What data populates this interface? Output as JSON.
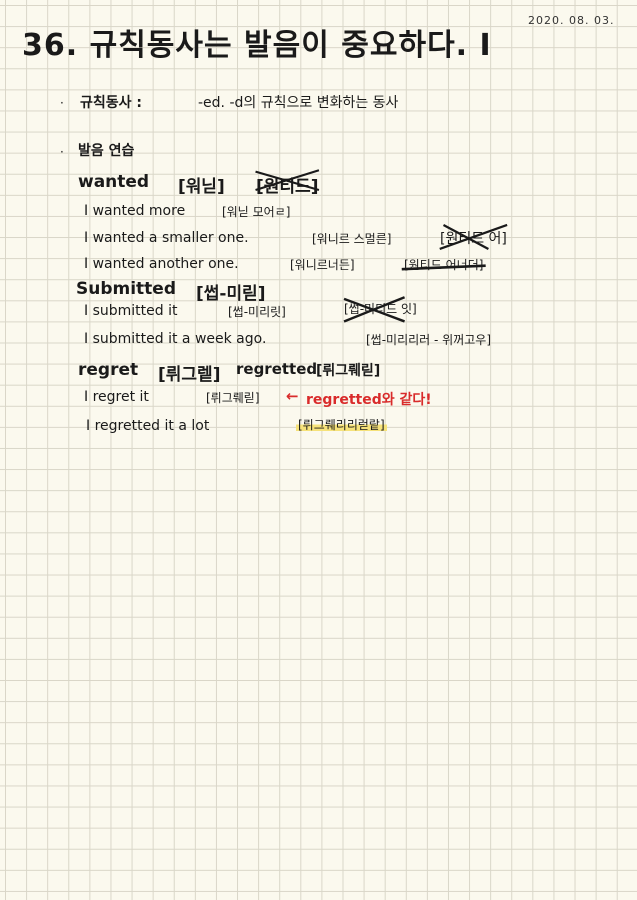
{
  "header": {
    "title": "36. 규칙동사는 발음이 중요하다. I",
    "date": "2020. 08. 03."
  },
  "bullets": {
    "symbol": "·",
    "definition_term": "규칙동사 :",
    "definition_text": "-ed. -d의 규칙으로 변화하는 동사",
    "practice_title": "발음 연습"
  },
  "wanted": {
    "word": "wanted",
    "pron": "[워닏]",
    "wrong_pron": "[원티드]",
    "ex1": "I wanted more",
    "ex1_pron": "[워닏 모어ㄹ]",
    "ex2": "I wanted a smaller one.",
    "ex2_pron": "[워니르 스멀른]",
    "ex2_wrong": "[원티드 어]",
    "ex3": "I wanted another one.",
    "ex3_pron": "[워니르너든]",
    "ex3_wrong": "[원티드 어너더]"
  },
  "submitted": {
    "word": "Submitted",
    "pron": "[썹-미릳]",
    "ex1": "I submitted it",
    "ex1_pron": "[썹-미리릿]",
    "ex1_wrong": "[썹-미티드 잇]",
    "ex2": "I submitted it a week ago.",
    "ex2_pron": "[썹-미리리러 - 위꺼고우]"
  },
  "regret": {
    "word": "regret",
    "pron": "[뤼그렡]",
    "past": "regretted",
    "past_pron": "[뤼그뤠릳]",
    "ex1": "I regret it",
    "ex1_pron": "[뤼그뤠릳]",
    "arrow": "←",
    "note": "regretted와 같다!",
    "ex2": "I regretted it a lot",
    "ex2_pron": "[뤼그뤠리리럳랕]"
  },
  "colors": {
    "paper": "#fbf9ee",
    "grid": "#d9d6c8",
    "ink": "#1a1a1a",
    "red": "#d92b2b",
    "highlight": "#f6e27a"
  }
}
